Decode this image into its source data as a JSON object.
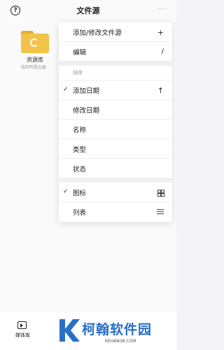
{
  "header": {
    "title": "文件源",
    "more": "···"
  },
  "folder": {
    "name": "资源库",
    "subtitle": "我的阿里云盘"
  },
  "menu": {
    "add_edit": "添加/修改文件源",
    "add_edit_icon": "plus-icon",
    "edit": "编辑",
    "edit_icon": "pencil-icon",
    "sort_label": "排序",
    "sort_items": [
      {
        "label": "添加日期",
        "checked": true,
        "icon": "arrow-up-icon"
      },
      {
        "label": "修改日期",
        "checked": false
      },
      {
        "label": "名称",
        "checked": false
      },
      {
        "label": "类型",
        "checked": false
      },
      {
        "label": "状态",
        "checked": false
      }
    ],
    "view_items": [
      {
        "label": "图标",
        "checked": true,
        "icon": "grid-icon"
      },
      {
        "label": "列表",
        "checked": false,
        "icon": "list-icon"
      }
    ]
  },
  "bottom_tab": {
    "label": "媒体库",
    "icon": "media-library-icon"
  },
  "watermark": {
    "text": "柯翰软件园",
    "url": "KEHAN38.COM",
    "color": "#2a6fc7"
  }
}
